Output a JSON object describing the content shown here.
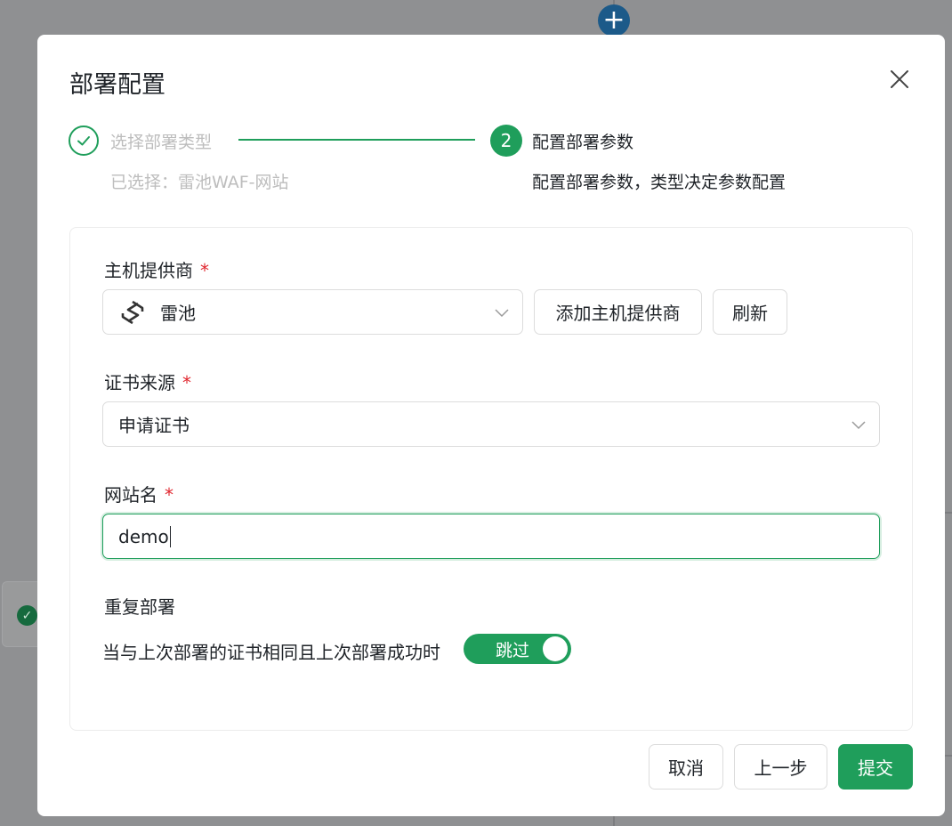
{
  "dialog": {
    "title": "部署配置",
    "close_icon": "close-icon"
  },
  "steps": [
    {
      "number": "1",
      "title": "选择部署类型",
      "description": "已选择：雷池WAF-网站",
      "status": "finished",
      "icon": "check-icon"
    },
    {
      "number": "2",
      "title": "配置部署参数",
      "description": "配置部署参数，类型决定参数配置",
      "status": "active"
    }
  ],
  "form": {
    "host_provider": {
      "label": "主机提供商",
      "required_mark": "*",
      "value": "雷池",
      "icon": "safeline-logo-icon",
      "add_button": "添加主机提供商",
      "refresh_button": "刷新"
    },
    "cert_source": {
      "label": "证书来源",
      "required_mark": "*",
      "value": "申请证书"
    },
    "site_name": {
      "label": "网站名",
      "required_mark": "*",
      "value": "demo"
    },
    "repeat_deploy": {
      "label": "重复部署",
      "condition_text": "当与上次部署的证书相同且上次部署成功时",
      "toggle_label": "跳过",
      "toggle_on": true
    }
  },
  "footer": {
    "cancel": "取消",
    "previous": "上一步",
    "submit": "提交"
  },
  "colors": {
    "primary": "#1f9e5b",
    "required": "#e0262e",
    "overlay": "#8f9092",
    "background_plus_button": "#1c5a89"
  }
}
